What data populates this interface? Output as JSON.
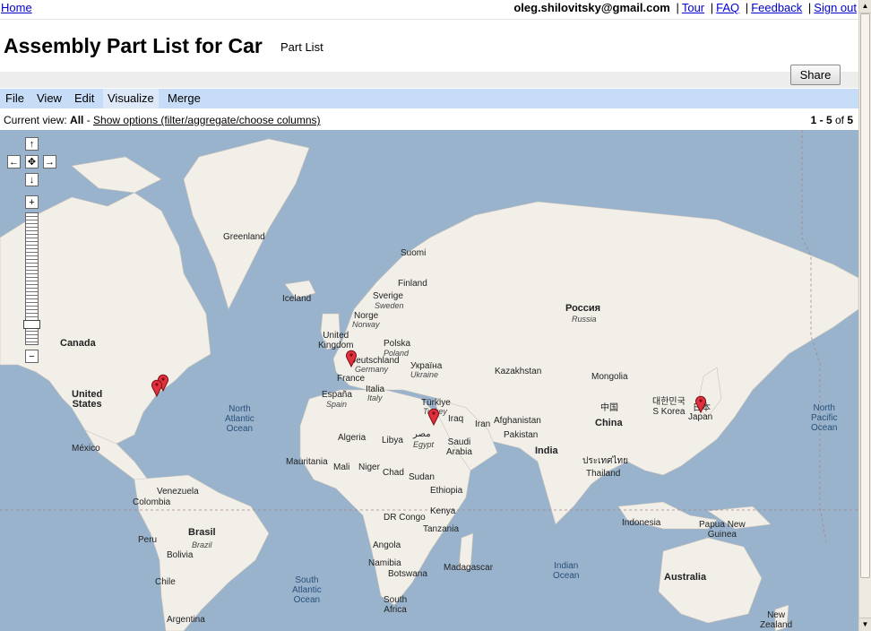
{
  "topbar": {
    "home": "Home",
    "email": "oleg.shilovitsky@gmail.com",
    "links": [
      "Tour",
      "FAQ",
      "Feedback",
      "Sign out"
    ],
    "separator": "|"
  },
  "header": {
    "title": "Assembly Part List for Car",
    "subtitle": "Part List",
    "share": "Share"
  },
  "menu": {
    "items": [
      "File",
      "View",
      "Edit",
      "Visualize",
      "Merge"
    ],
    "active": "Visualize"
  },
  "view": {
    "prefix": "Current view: ",
    "current": "All",
    "dash": " - ",
    "options_link": "Show options (filter/aggregate/choose columns)",
    "pager_range": "1 - 5",
    "pager_of": " of ",
    "pager_total": "5"
  },
  "map": {
    "labels": {
      "greenland": "Greenland",
      "iceland": "Iceland",
      "suomi": "Suomi",
      "finland": "Finland",
      "sverige": "Sverige",
      "sweden": "Sweden",
      "norge": "Norge",
      "norway": "Norway",
      "uk": "United\nKingdom",
      "polska": "Polska",
      "poland": "Poland",
      "ukraina": "Україна",
      "ukraine": "Ukraine",
      "deutschland": "Deutschland",
      "germany": "Germany",
      "france": "France",
      "italia": "Italia",
      "italy": "Italy",
      "espana": "España",
      "spain": "Spain",
      "turkiye": "Türkiye",
      "turkey": "Turkey",
      "iraq": "Iraq",
      "iran": "Iran",
      "rossiya": "Россия",
      "russia": "Russia",
      "kazakhstan": "Kazakhstan",
      "mongolia": "Mongolia",
      "china_native": "中国",
      "china": "China",
      "south_korea": "대한민국\nS Korea",
      "japan_native": "日本",
      "japan": "Japan",
      "afghanistan": "Afghanistan",
      "pakistan": "Pakistan",
      "india": "India",
      "thailand_native": "ประเทศไทย",
      "thailand": "Thailand",
      "indonesia": "Indonesia",
      "png": "Papua New\nGuinea",
      "australia": "Australia",
      "new_zealand": "New\nZealand",
      "canada": "Canada",
      "united_states": "United\nStates",
      "mexico": "México",
      "venezuela": "Venezuela",
      "colombia": "Colombia",
      "peru": "Peru",
      "brasil": "Brasil",
      "brazil": "Brazil",
      "bolivia": "Bolivia",
      "chile": "Chile",
      "argentina": "Argentina",
      "algeria": "Algeria",
      "libya": "Libya",
      "misr": "مصر",
      "egypt": "Egypt",
      "mauritania": "Mauritania",
      "mali": "Mali",
      "niger": "Niger",
      "chad": "Chad",
      "sudan": "Sudan",
      "ethiopia": "Ethiopia",
      "saudi": "Saudi\nArabia",
      "dr_congo": "DR Congo",
      "kenya": "Kenya",
      "tanzania": "Tanzania",
      "angola": "Angola",
      "namibia": "Namibia",
      "botswana": "Botswana",
      "madagascar": "Madagascar",
      "south_africa": "South\nAfrica",
      "north_atlantic": "North\nAtlantic\nOcean",
      "south_atlantic": "South\nAtlantic\nOcean",
      "indian_ocean": "Indian\nOcean",
      "north_pacific": "North\nPacific\nOcean"
    }
  },
  "colors": {
    "water": "#99b3cc",
    "land": "#f2efe9",
    "menubar": "#c7ddf7",
    "marker": "#e03040",
    "link": "#0000cc"
  }
}
